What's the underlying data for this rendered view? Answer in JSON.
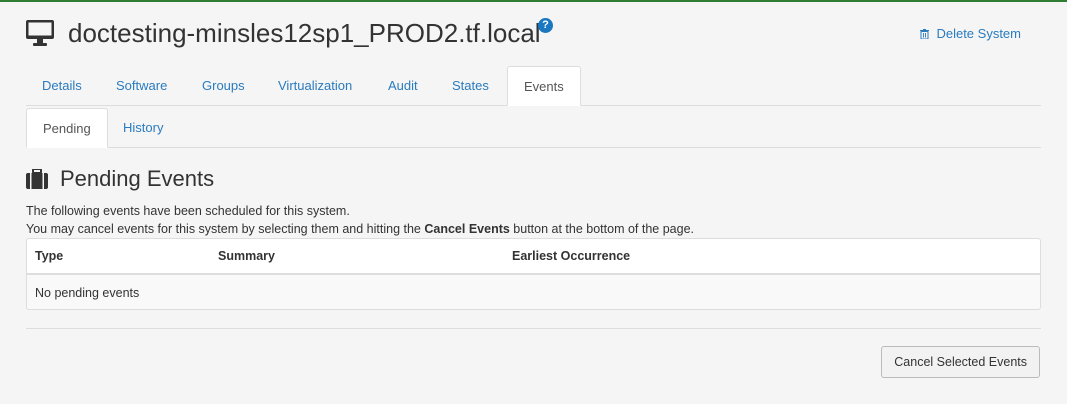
{
  "system": {
    "title": "doctesting-minsles12sp1_PROD2.tf.local",
    "help_icon": "?"
  },
  "header_actions": {
    "delete_label": "Delete System"
  },
  "tabs": [
    {
      "label": "Details"
    },
    {
      "label": "Software"
    },
    {
      "label": "Groups"
    },
    {
      "label": "Virtualization"
    },
    {
      "label": "Audit"
    },
    {
      "label": "States"
    },
    {
      "label": "Events",
      "active": true
    }
  ],
  "subtabs": [
    {
      "label": "Pending",
      "active": true
    },
    {
      "label": "History"
    }
  ],
  "section": {
    "title": "Pending Events",
    "line1": "The following events have been scheduled for this system.",
    "line2_prefix": "You may cancel events for this system by selecting them and hitting the ",
    "line2_bold": "Cancel Events",
    "line2_suffix": " button at the bottom of the page."
  },
  "table": {
    "columns": [
      "Type",
      "Summary",
      "Earliest Occurrence"
    ],
    "empty_message": "No pending events"
  },
  "footer": {
    "button_label": "Cancel Selected Events"
  },
  "colors": {
    "accent_link": "#2a7bbf",
    "top_line": "#2e7d32",
    "help_icon": "#1a78c2"
  },
  "icons": {
    "system": "desktop-monitor-icon",
    "section": "briefcase-icon",
    "delete": "trash-icon"
  }
}
